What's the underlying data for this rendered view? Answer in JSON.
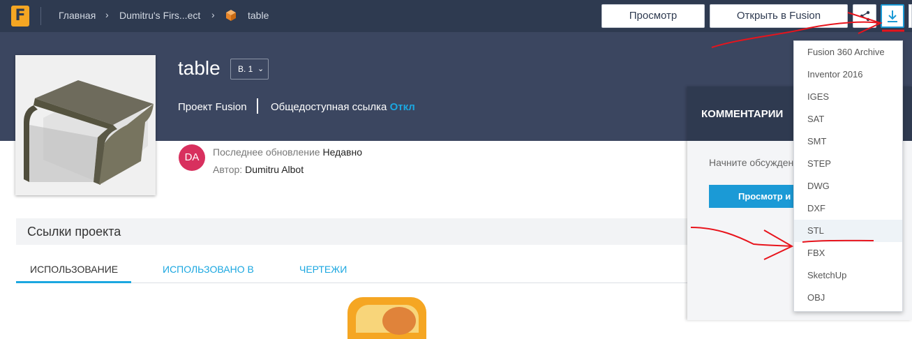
{
  "topbar": {
    "breadcrumbs": [
      "Главная",
      "Dumitru's Firs...ect",
      "table"
    ],
    "preview_button": "Просмотр",
    "open_button": "Открыть в Fusion",
    "share_icon": "share-icon",
    "download_icon": "download-icon"
  },
  "design": {
    "title": "table",
    "version": "В. 1",
    "project": "Проект Fusion",
    "public_link_label": "Общедоступная ссылка",
    "public_link_value": "Откл"
  },
  "info": {
    "avatar_initials": "DA",
    "updated_label": "Последнее обновление",
    "updated_value": "Недавно",
    "author_label": "Автор:",
    "author_value": "Dumitru Albot"
  },
  "project_links": {
    "title": "Ссылки проекта",
    "tabs": [
      "ИСПОЛЬЗОВАНИЕ",
      "ИСПОЛЬЗОВАНО В",
      "ЧЕРТЕЖИ"
    ]
  },
  "comments": {
    "title": "КОММЕНТАРИИ",
    "prompt": "Начните обсужден",
    "button": "Просмотр и"
  },
  "download_menu": {
    "items": [
      "Fusion 360 Archive",
      "Inventor 2016",
      "IGES",
      "SAT",
      "SMT",
      "STEP",
      "DWG",
      "DXF",
      "STL",
      "FBX",
      "SketchUp",
      "OBJ"
    ],
    "highlighted": "STL"
  },
  "colors": {
    "topbar": "#2e3a50",
    "hero": "#3b4660",
    "accent": "#1b9ad6",
    "avatar": "#d8305e",
    "annotation": "#e8141c"
  }
}
